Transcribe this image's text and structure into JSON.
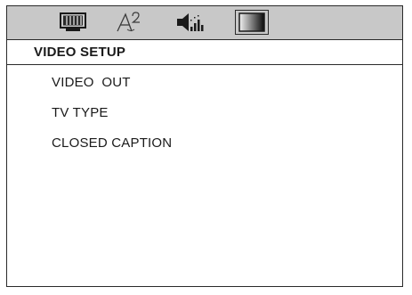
{
  "tabs": [
    {
      "icon": "tv-icon",
      "selected": false
    },
    {
      "icon": "language-icon",
      "selected": false
    },
    {
      "icon": "speaker-icon",
      "selected": false
    },
    {
      "icon": "video-icon",
      "selected": true
    }
  ],
  "section": {
    "title": "VIDEO SETUP"
  },
  "menu": {
    "items": [
      {
        "label": "VIDEO  OUT"
      },
      {
        "label": "TV TYPE"
      },
      {
        "label": "CLOSED CAPTION"
      }
    ]
  }
}
